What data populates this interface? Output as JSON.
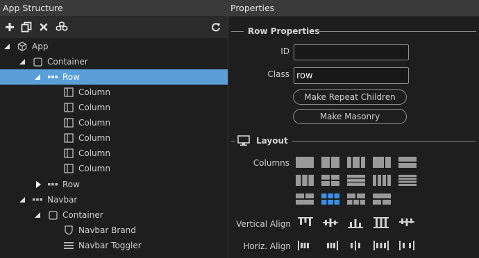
{
  "left_panel": {
    "title": "App Structure",
    "toolbar": [
      {
        "name": "add",
        "icon": "plus-icon"
      },
      {
        "name": "duplicate",
        "icon": "copy-icon"
      },
      {
        "name": "delete",
        "icon": "x-icon"
      },
      {
        "name": "components",
        "icon": "cubes-icon"
      },
      {
        "name": "refresh",
        "icon": "refresh-icon"
      }
    ],
    "tree": [
      {
        "label": "App",
        "icon": "cube-icon",
        "toggle": "expanded",
        "level": 0
      },
      {
        "label": "Container",
        "icon": "square-icon",
        "toggle": "expanded",
        "level": 1
      },
      {
        "label": "Row",
        "icon": "dots-icon",
        "toggle": "expanded",
        "level": 2,
        "selected": true
      },
      {
        "label": "Column",
        "icon": "column-icon",
        "toggle": "none",
        "level": 3
      },
      {
        "label": "Column",
        "icon": "column-icon",
        "toggle": "none",
        "level": 3
      },
      {
        "label": "Column",
        "icon": "column-icon",
        "toggle": "none",
        "level": 3
      },
      {
        "label": "Column",
        "icon": "column-icon",
        "toggle": "none",
        "level": 3
      },
      {
        "label": "Column",
        "icon": "column-icon",
        "toggle": "none",
        "level": 3
      },
      {
        "label": "Column",
        "icon": "column-icon",
        "toggle": "none",
        "level": 3
      },
      {
        "label": "Row",
        "icon": "dots-icon",
        "toggle": "collapsed",
        "level": 2
      },
      {
        "label": "Navbar",
        "icon": "dots-icon",
        "toggle": "expanded",
        "level": 1
      },
      {
        "label": "Container",
        "icon": "square-icon",
        "toggle": "expanded",
        "level": 2
      },
      {
        "label": "Navbar Brand",
        "icon": "shield-icon",
        "toggle": "none",
        "level": 3
      },
      {
        "label": "Navbar Toggler",
        "icon": "hamburger-icon",
        "toggle": "none",
        "level": 3
      }
    ]
  },
  "right_panel": {
    "title": "Properties",
    "row_properties": {
      "heading": "Row Properties",
      "id_label": "ID",
      "id_value": "",
      "class_label": "Class",
      "class_value": "row",
      "repeat_button": "Make Repeat Children",
      "masonry_button": "Make Masonry"
    },
    "layout": {
      "heading": "Layout",
      "heading_icon": "monitor-icon",
      "columns_label": "Columns",
      "vertical_align_label": "Vertical Align",
      "horiz_align_label": "Horiz. Align",
      "selected_preset": "3x2 grid",
      "accent_color": "#3f8fe0"
    }
  }
}
